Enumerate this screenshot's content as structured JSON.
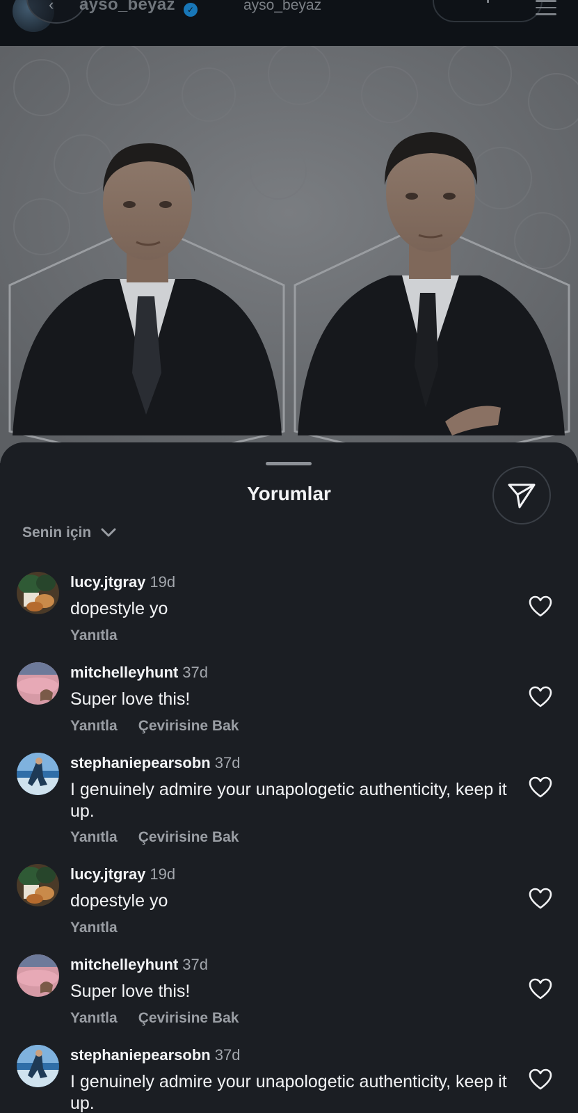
{
  "top_bar": {
    "account_handle": "ayso_beyaz",
    "center_handle": "ayso_beyaz"
  },
  "comments_sheet": {
    "title": "Yorumlar",
    "sort_label": "Senin için",
    "comments": [
      {
        "username": "lucy.jtgray",
        "time": "19d",
        "text": "dopestyle yo",
        "reply": "Yanıtla",
        "translate": ""
      },
      {
        "username": "mitchelleyhunt",
        "time": "37d",
        "text": "Super love this!",
        "reply": "Yanıtla",
        "translate": "Çevirisine Bak"
      },
      {
        "username": "stephaniepearsobn",
        "time": "37d",
        "text": "I genuinely admire your unapologetic authenticity, keep it up.",
        "reply": "Yanıtla",
        "translate": "Çevirisine Bak"
      },
      {
        "username": "lucy.jtgray",
        "time": "19d",
        "text": "dopestyle yo",
        "reply": "Yanıtla",
        "translate": ""
      },
      {
        "username": "mitchelleyhunt",
        "time": "37d",
        "text": "Super love this!",
        "reply": "Yanıtla",
        "translate": "Çevirisine Bak"
      },
      {
        "username": "stephaniepearsobn",
        "time": "37d",
        "text": "I genuinely admire your unapologetic authenticity, keep it up.",
        "reply": "",
        "translate": ""
      }
    ]
  }
}
